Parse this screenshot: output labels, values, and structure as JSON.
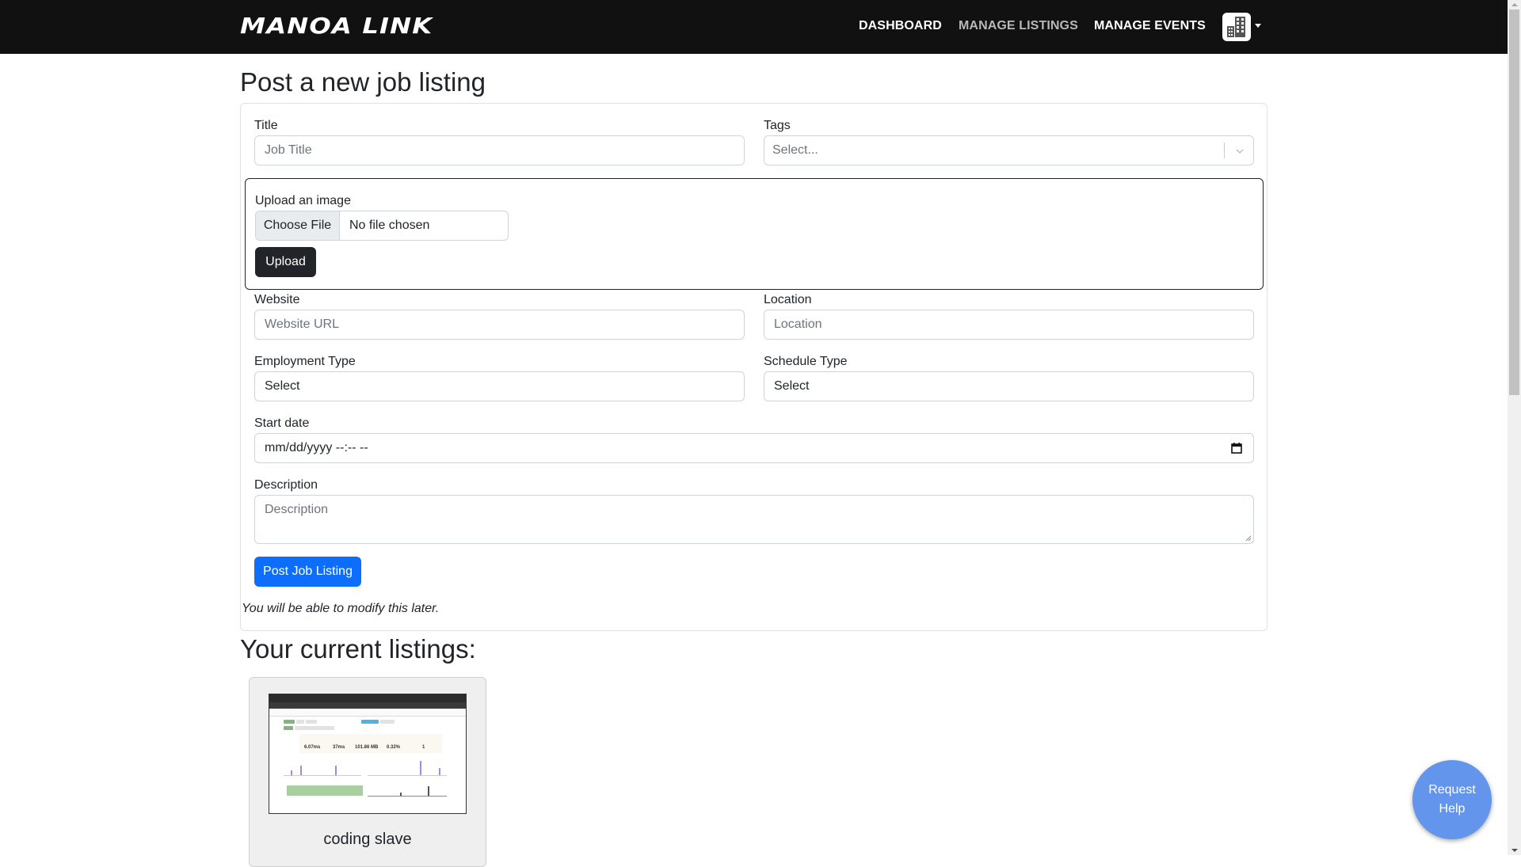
{
  "navbar": {
    "logo": "MANOA LINK",
    "links": [
      {
        "label": "DASHBOARD",
        "state": "default"
      },
      {
        "label": "MANAGE LISTINGS",
        "state": "muted"
      },
      {
        "label": "MANAGE EVENTS",
        "state": "default"
      }
    ],
    "profile_icon": "building-icon"
  },
  "form": {
    "heading": "Post a new job listing",
    "title": {
      "label": "Title",
      "placeholder": "Job Title",
      "value": ""
    },
    "tags": {
      "label": "Tags",
      "placeholder": "Select..."
    },
    "upload": {
      "label": "Upload an image",
      "choose_file_label": "Choose File",
      "file_status": "No file chosen",
      "upload_button": "Upload"
    },
    "website": {
      "label": "Website",
      "placeholder": "Website URL",
      "value": ""
    },
    "location": {
      "label": "Location",
      "placeholder": "Location",
      "value": ""
    },
    "employment_type": {
      "label": "Employment Type",
      "selected": "Select"
    },
    "schedule_type": {
      "label": "Schedule Type",
      "selected": "Select"
    },
    "start_date": {
      "label": "Start date",
      "value": "mm/dd/yyyy --:-- --"
    },
    "description": {
      "label": "Description",
      "placeholder": "Description",
      "value": ""
    },
    "submit_button": "Post Job Listing",
    "note": "You will be able to modify this later."
  },
  "listings": {
    "heading": "Your current listings:",
    "items": [
      {
        "title": "coding slave",
        "thumbnail": {
          "stats": [
            "6.07ms",
            "37ms",
            "101.86 MB",
            "0.32%",
            "1"
          ]
        }
      }
    ]
  },
  "help_button": {
    "line1": "Request",
    "line2": "Help"
  },
  "colors": {
    "navbar_bg": "#111111",
    "primary": "#0d6efd",
    "dark_button": "#212529",
    "help_button": "#6495ed"
  }
}
